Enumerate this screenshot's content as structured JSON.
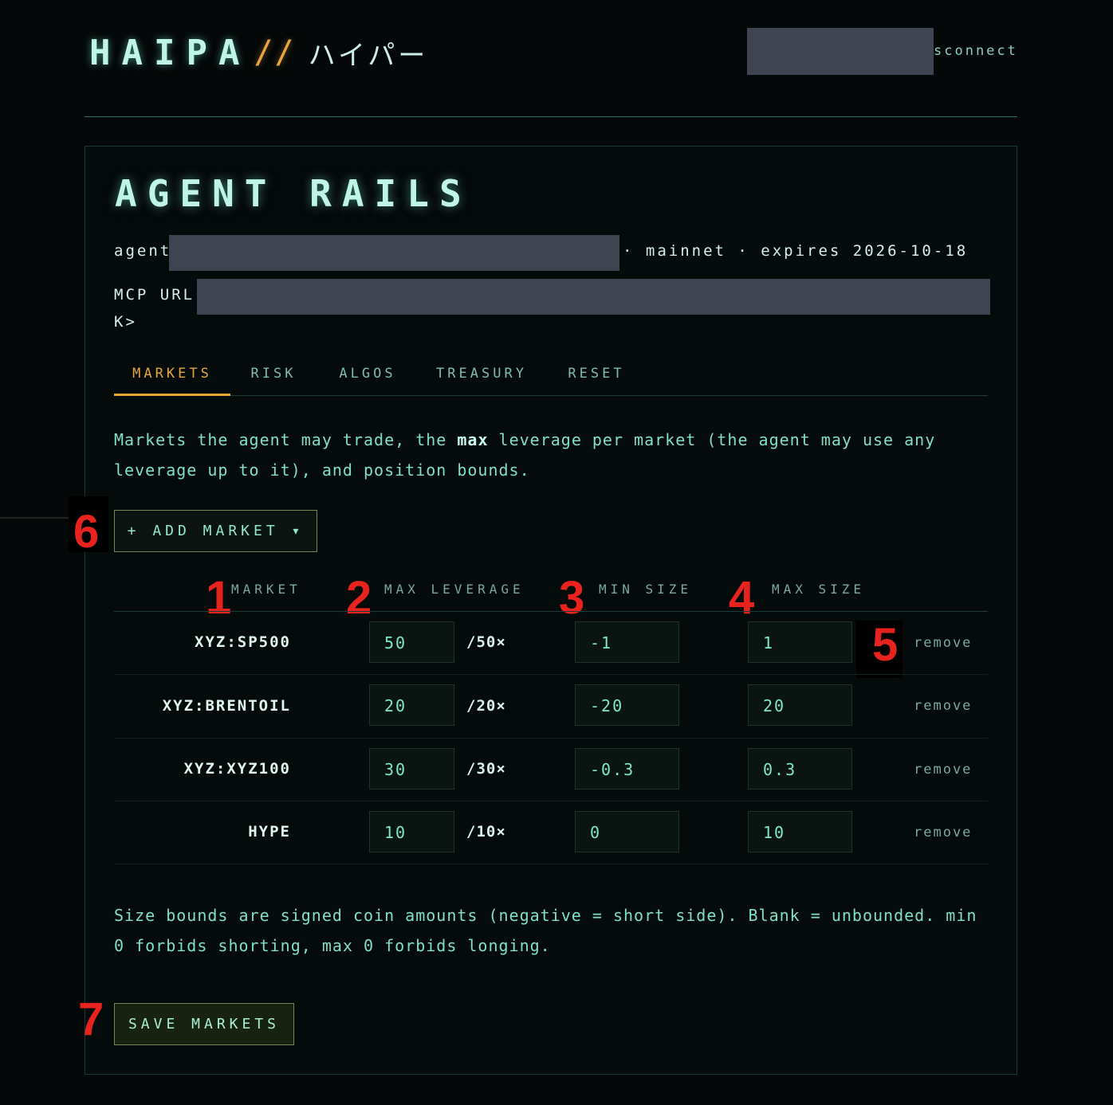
{
  "header": {
    "logo_main": "HAIPA",
    "logo_sep": "//",
    "logo_jp": "ハイパー",
    "disconnect_label": "sconnect"
  },
  "page": {
    "title": "AGENT RAILS",
    "agent_label": "agent",
    "network": "· mainnet · expires 2026-10-18",
    "mcp_label": "MCP URL:",
    "mcp_suffix": "K>"
  },
  "tabs": [
    {
      "label": "MARKETS",
      "active": true
    },
    {
      "label": "RISK",
      "active": false
    },
    {
      "label": "ALGOS",
      "active": false
    },
    {
      "label": "TREASURY",
      "active": false
    },
    {
      "label": "RESET",
      "active": false
    }
  ],
  "markets": {
    "desc_pre": "Markets the agent may trade, the ",
    "desc_bold": "max",
    "desc_post": " leverage per market (the agent may use any leverage up to it), and position bounds.",
    "add_label": "+ ADD MARKET ▾",
    "columns": {
      "market": "MARKET",
      "max_leverage": "MAX LEVERAGE",
      "min_size": "MIN SIZE",
      "max_size": "MAX SIZE"
    },
    "rows": [
      {
        "market": "XYZ:SP500",
        "leverage": "50",
        "max_lev": "/50×",
        "min": "-1",
        "max": "1",
        "remove": "remove"
      },
      {
        "market": "XYZ:BRENTOIL",
        "leverage": "20",
        "max_lev": "/20×",
        "min": "-20",
        "max": "20",
        "remove": "remove"
      },
      {
        "market": "XYZ:XYZ100",
        "leverage": "30",
        "max_lev": "/30×",
        "min": "-0.3",
        "max": "0.3",
        "remove": "remove"
      },
      {
        "market": "HYPE",
        "leverage": "10",
        "max_lev": "/10×",
        "min": "0",
        "max": "10",
        "remove": "remove"
      }
    ],
    "footnote": "Size bounds are signed coin amounts (negative = short side). Blank = unbounded. min 0 forbids shorting, max 0 forbids longing.",
    "save_label": "SAVE MARKETS"
  },
  "annotations": [
    "1",
    "2",
    "3",
    "4",
    "5",
    "6",
    "7"
  ],
  "colors": {
    "accent": "#e8a63a",
    "text": "#8fe0cc",
    "marker": "#e8231d",
    "background": "#040808"
  }
}
